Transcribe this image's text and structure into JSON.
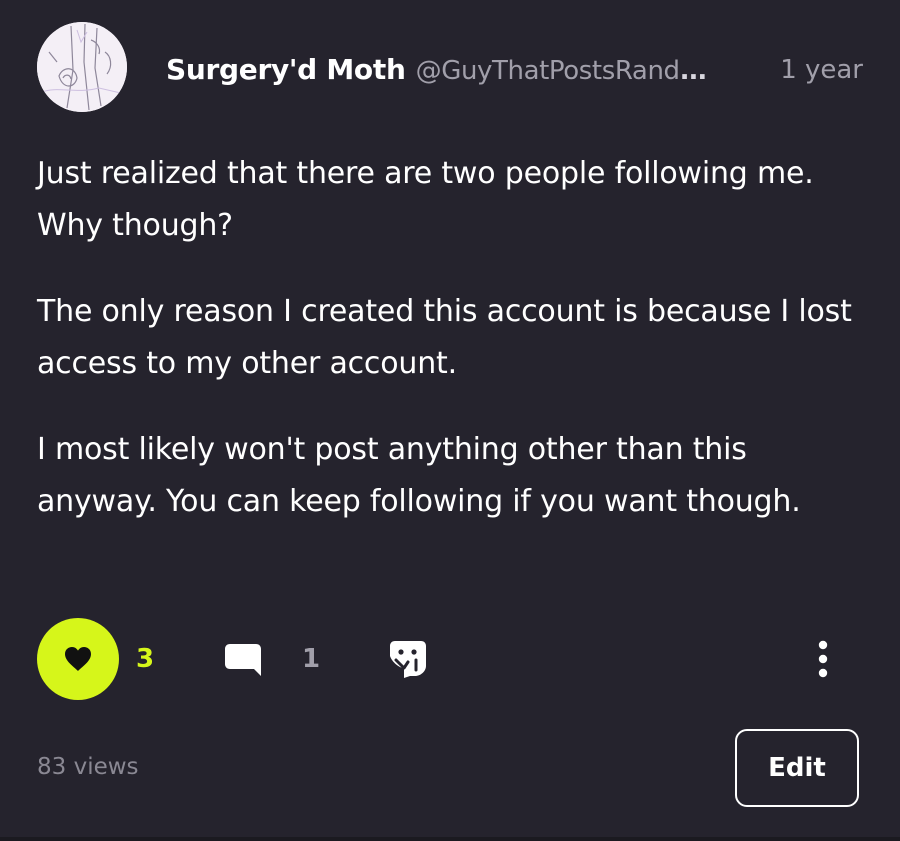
{
  "post": {
    "author": {
      "name": "Surgery'd Moth",
      "handle": "@GuyThatPostsRand",
      "handle_ellipsis": "..."
    },
    "timestamp": "1 year",
    "paragraphs": [
      "Just realized that there are two people following me. Why though?",
      "The only reason I created this account is because I lost access to my other account.",
      "I most likely won't post anything other than this anyway. You can keep following if you want though."
    ],
    "actions": {
      "like_count": "3",
      "comment_count": "1",
      "liked": true
    },
    "views": "83 views",
    "edit_label": "Edit"
  },
  "icons": {
    "like": "heart-icon",
    "comment": "speech-bubble-icon",
    "share": "share-icon",
    "more": "vertical-ellipsis-icon"
  },
  "colors": {
    "background": "#25232d",
    "accent": "#d6f61a",
    "text_primary": "#ffffff",
    "text_muted": "#a19faa"
  }
}
